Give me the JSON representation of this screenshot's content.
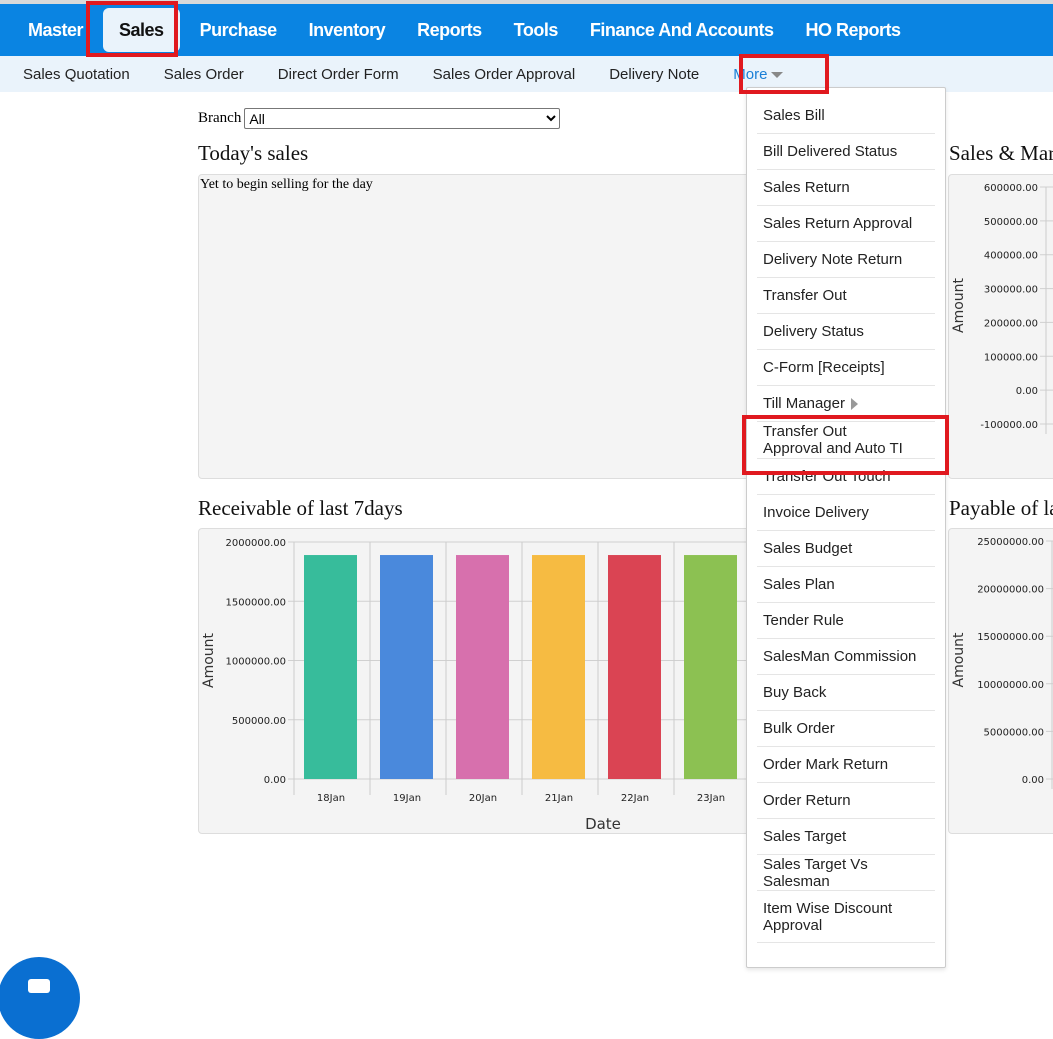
{
  "nav": {
    "items": [
      "Master",
      "Sales",
      "Purchase",
      "Inventory",
      "Reports",
      "Tools",
      "Finance And Accounts",
      "HO Reports"
    ],
    "active": "Sales"
  },
  "subnav": {
    "items": [
      "Sales Quotation",
      "Sales Order",
      "Direct Order Form",
      "Sales Order Approval",
      "Delivery Note"
    ],
    "more": "More"
  },
  "branch": {
    "label": "Branch",
    "value": "All"
  },
  "today": {
    "title": "Today's sales",
    "message": "Yet to begin selling for the day"
  },
  "sales_margin": {
    "title": "Sales & Mar"
  },
  "receivable": {
    "title": "Receivable of last 7days"
  },
  "payable": {
    "title": "Payable of la"
  },
  "dropdown": {
    "items": [
      "Sales Bill",
      "Bill Delivered Status",
      "Sales Return",
      "Sales Return Approval",
      "Delivery Note Return",
      "Transfer Out",
      "Delivery Status",
      "C-Form [Receipts]",
      "Till Manager",
      "Transfer Out Approval and Auto TI",
      "Transfer Out Touch",
      "Invoice Delivery",
      "Sales Budget",
      "Sales Plan",
      "Tender Rule",
      "SalesMan Commission",
      "Buy Back",
      "Bulk Order",
      "Order Mark Return",
      "Order Return",
      "Sales Target",
      "Sales Target Vs Salesman",
      "Item Wise Discount Approval"
    ]
  },
  "chart_data": [
    {
      "type": "bar",
      "title": "Receivable of last 7days",
      "xlabel": "Date",
      "ylabel": "Amount",
      "ylim": [
        0,
        2000000
      ],
      "yticks": [
        "0.00",
        "500000.00",
        "1000000.00",
        "1500000.00",
        "2000000.00"
      ],
      "categories": [
        "18Jan",
        "19Jan",
        "20Jan",
        "21Jan",
        "22Jan",
        "23Jan"
      ],
      "values": [
        1890000,
        1890000,
        1890000,
        1890000,
        1890000,
        1890000
      ],
      "colors": [
        "#37bc9b",
        "#4a89dc",
        "#d770ad",
        "#f6bb42",
        "#da4453",
        "#8cc152"
      ]
    },
    {
      "type": "bar",
      "title": "Sales & Mar",
      "ylabel": "Amount",
      "ylim": [
        -100000,
        600000
      ],
      "yticks": [
        "-100000.00",
        "0.00",
        "100000.00",
        "200000.00",
        "300000.00",
        "400000.00",
        "500000.00",
        "600000.00"
      ]
    },
    {
      "type": "bar",
      "title": "Payable of la",
      "ylabel": "Amount",
      "ylim": [
        0,
        25000000
      ],
      "yticks": [
        "0.00",
        "5000000.00",
        "10000000.00",
        "15000000.00",
        "20000000.00",
        "25000000.00"
      ]
    }
  ]
}
